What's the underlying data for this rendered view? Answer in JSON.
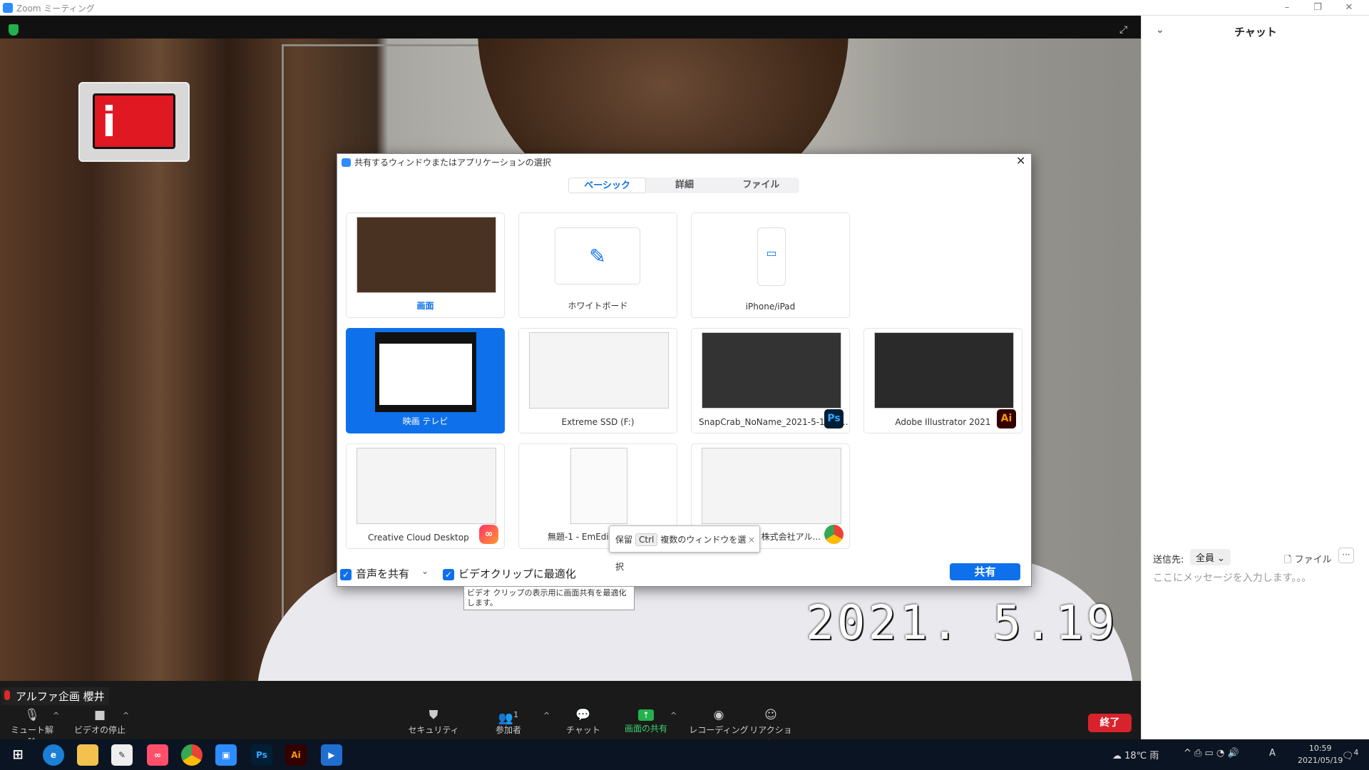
{
  "window": {
    "title": "Zoom ミーティング",
    "min": "–",
    "max": "❐",
    "close": "✕"
  },
  "video": {
    "timestamp": "2021. 5.19",
    "participant_name": "アルファ企画 櫻井",
    "logo_letter": "i"
  },
  "toolbar": {
    "mute": "ミュート解除",
    "stop_video": "ビデオの停止",
    "security": "セキュリティ",
    "participants": "参加者",
    "participant_count": "1",
    "chat": "チャット",
    "share_screen": "画面の共有",
    "record": "レコーディング",
    "reactions": "リアクション",
    "end": "終了"
  },
  "chat": {
    "title": "チャット",
    "send_to_label": "送信先:",
    "send_to_value": "全員",
    "file": "ファイル",
    "more": "···",
    "placeholder": "ここにメッセージを入力します。。。"
  },
  "dialog": {
    "title": "共有するウィンドウまたはアプリケーションの選択",
    "close": "✕",
    "tabs": [
      {
        "label": "ベーシック",
        "active": true
      },
      {
        "label": "詳細"
      },
      {
        "label": "ファイル"
      }
    ],
    "tiles": [
      {
        "caption": "画面"
      },
      {
        "caption": "ホワイトボード"
      },
      {
        "caption": "iPhone/iPad"
      },
      {
        "caption": "映画 テレビ",
        "selected": true
      },
      {
        "caption": "Extreme SSD (F:)"
      },
      {
        "caption": "SnapCrab_NoName_2021-5-19_1...",
        "badge": "Ps"
      },
      {
        "caption": "Adobe Illustrator 2021",
        "badge": "Ai"
      },
      {
        "caption": "Creative Cloud Desktop"
      },
      {
        "caption": "無題-1 - EmEdi"
      },
      {
        "caption": "株式会社アル..."
      }
    ],
    "share_audio": "音声を共有",
    "optimize_video": "ビデオクリップに最適化",
    "share_button": "共有",
    "hold_tooltip": {
      "prefix": "保留",
      "key": "Ctrl",
      "text": "複数のウィンドウを選択",
      "close": "×"
    },
    "optimize_tooltip": "ビデオ クリップの表示用に画面共有を最適化します。"
  },
  "taskbar": {
    "weather": "18℃ 雨",
    "ime": "A",
    "time": "10:59",
    "date": "2021/05/19",
    "notif_count": "4",
    "apps": [
      "Ps",
      "Ai"
    ]
  },
  "colors": {
    "accent": "#0e71eb",
    "end": "#d9232c",
    "share_green": "#23b14d"
  }
}
